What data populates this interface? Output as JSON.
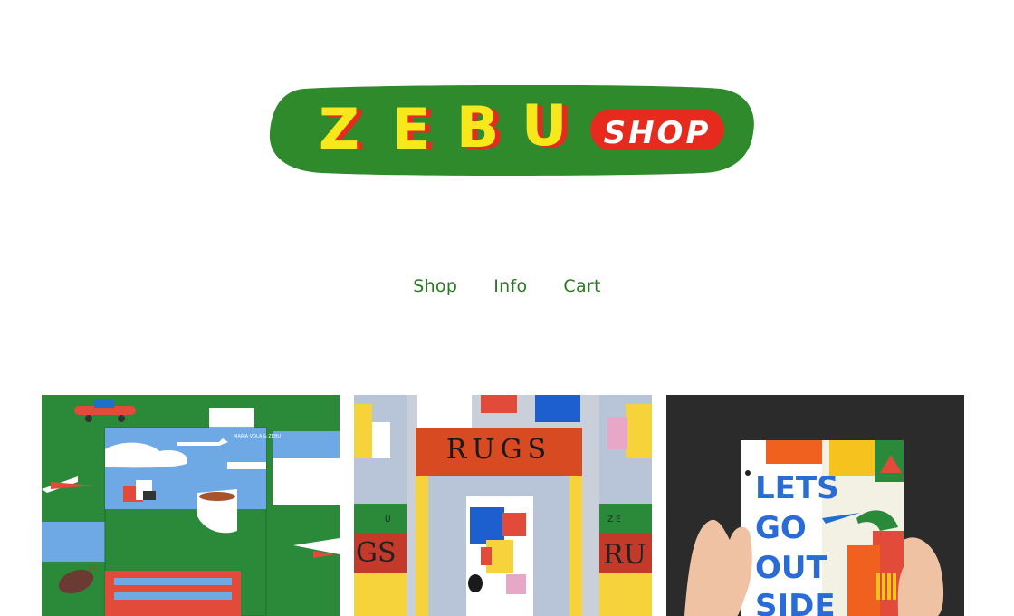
{
  "logo": {
    "letters": [
      "Z",
      "E",
      "B",
      "U"
    ],
    "shop_label": "SHOP",
    "colors": {
      "bg_green": "#2e8a2a",
      "letter_yellow": "#f7e81b",
      "letter_shadow_red": "#e62b1e",
      "pill_red": "#e62b1e",
      "pill_text": "#ffffff"
    }
  },
  "nav": {
    "items": [
      "Shop",
      "Info",
      "Cart"
    ],
    "color": "#2a7a22"
  },
  "products": [
    {
      "kind": "poster-book",
      "small_title": "MARIA VOLA & ZEBU"
    },
    {
      "kind": "rugs-book",
      "cover_title": "RUGS",
      "side_left": "GS",
      "side_right": "RU",
      "side_top_left": "U",
      "side_top_right": "Z E"
    },
    {
      "kind": "lets-go-outside-book",
      "lines": [
        "LETS",
        "GO",
        "OUT",
        "SIDE"
      ]
    }
  ]
}
